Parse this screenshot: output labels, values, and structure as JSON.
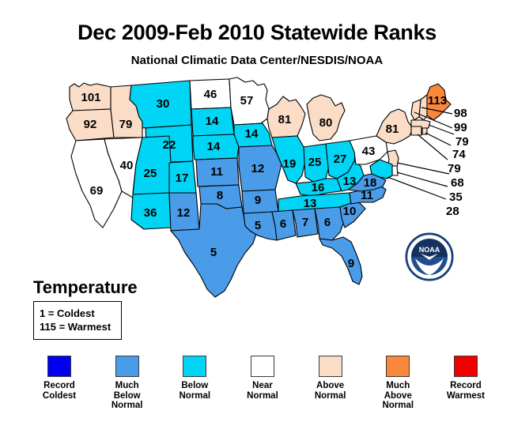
{
  "header": {
    "title": "Dec 2009-Feb 2010 Statewide Ranks",
    "subtitle": "National Climatic Data Center/NESDIS/NOAA"
  },
  "temperature_panel": {
    "heading": "Temperature",
    "scale_min": "1 = Coldest",
    "scale_max": "115 = Warmest"
  },
  "legend": {
    "items": [
      {
        "label": "Record\nColdest",
        "color": "#0000ee"
      },
      {
        "label": "Much\nBelow\nNormal",
        "color": "#4a9be8"
      },
      {
        "label": "Below\nNormal",
        "color": "#00d5f5"
      },
      {
        "label": "Near\nNormal",
        "color": "#ffffff"
      },
      {
        "label": "Above\nNormal",
        "color": "#fbdcc6"
      },
      {
        "label": "Much\nAbove\nNormal",
        "color": "#f9873c"
      },
      {
        "label": "Record\nWarmest",
        "color": "#f00000"
      }
    ]
  },
  "logo": {
    "name": "NOAA",
    "text": "NOAA",
    "color": "#1a3f7a"
  },
  "chart_data": {
    "type": "map",
    "title": "Dec 2009-Feb 2010 Statewide Ranks",
    "subtitle": "National Climatic Data Center/NESDIS/NOAA",
    "value_name": "Statewide Temperature Rank",
    "value_range": [
      1,
      115
    ],
    "value_min_label": "1 = Coldest",
    "value_max_label": "115 = Warmest",
    "color_bins": [
      {
        "name": "Record Coldest",
        "color": "#0000ee"
      },
      {
        "name": "Much Below Normal",
        "color": "#4a9be8"
      },
      {
        "name": "Below Normal",
        "color": "#00d5f5"
      },
      {
        "name": "Near Normal",
        "color": "#ffffff"
      },
      {
        "name": "Above Normal",
        "color": "#fbdcc6"
      },
      {
        "name": "Much Above Normal",
        "color": "#f9873c"
      },
      {
        "name": "Record Warmest",
        "color": "#f00000"
      }
    ],
    "states": [
      {
        "code": "WA",
        "value": 101,
        "category": "Above Normal"
      },
      {
        "code": "OR",
        "value": 92,
        "category": "Above Normal"
      },
      {
        "code": "ID",
        "value": 79,
        "category": "Above Normal"
      },
      {
        "code": "MT",
        "value": 30,
        "category": "Below Normal"
      },
      {
        "code": "WY",
        "value": 22,
        "category": "Below Normal"
      },
      {
        "code": "CA",
        "value": 69,
        "category": "Near Normal"
      },
      {
        "code": "NV",
        "value": 40,
        "category": "Near Normal"
      },
      {
        "code": "UT",
        "value": 25,
        "category": "Below Normal"
      },
      {
        "code": "CO",
        "value": 17,
        "category": "Below Normal"
      },
      {
        "code": "AZ",
        "value": 36,
        "category": "Below Normal"
      },
      {
        "code": "NM",
        "value": 12,
        "category": "Much Below Normal"
      },
      {
        "code": "ND",
        "value": 46,
        "category": "Near Normal"
      },
      {
        "code": "SD",
        "value": 14,
        "category": "Below Normal"
      },
      {
        "code": "NE",
        "value": 14,
        "category": "Below Normal"
      },
      {
        "code": "KS",
        "value": 11,
        "category": "Much Below Normal"
      },
      {
        "code": "OK",
        "value": 8,
        "category": "Much Below Normal"
      },
      {
        "code": "TX",
        "value": 5,
        "category": "Much Below Normal"
      },
      {
        "code": "MN",
        "value": 57,
        "category": "Near Normal"
      },
      {
        "code": "IA",
        "value": 14,
        "category": "Below Normal"
      },
      {
        "code": "MO",
        "value": 12,
        "category": "Much Below Normal"
      },
      {
        "code": "AR",
        "value": 9,
        "category": "Much Below Normal"
      },
      {
        "code": "LA",
        "value": 5,
        "category": "Much Below Normal"
      },
      {
        "code": "WI",
        "value": 81,
        "category": "Above Normal"
      },
      {
        "code": "MI",
        "value": 80,
        "category": "Above Normal"
      },
      {
        "code": "IL",
        "value": 19,
        "category": "Below Normal"
      },
      {
        "code": "IN",
        "value": 25,
        "category": "Below Normal"
      },
      {
        "code": "OH",
        "value": 27,
        "category": "Below Normal"
      },
      {
        "code": "KY",
        "value": 16,
        "category": "Below Normal"
      },
      {
        "code": "TN",
        "value": 13,
        "category": "Below Normal"
      },
      {
        "code": "MS",
        "value": 6,
        "category": "Much Below Normal"
      },
      {
        "code": "AL",
        "value": 7,
        "category": "Much Below Normal"
      },
      {
        "code": "GA",
        "value": 6,
        "category": "Much Below Normal"
      },
      {
        "code": "FL",
        "value": 9,
        "category": "Much Below Normal"
      },
      {
        "code": "SC",
        "value": 10,
        "category": "Much Below Normal"
      },
      {
        "code": "NC",
        "value": 11,
        "category": "Much Below Normal"
      },
      {
        "code": "VA",
        "value": 18,
        "category": "Much Below Normal"
      },
      {
        "code": "WV",
        "value": 13,
        "category": "Below Normal"
      },
      {
        "code": "PA",
        "value": 43,
        "category": "Near Normal"
      },
      {
        "code": "NY",
        "value": 81,
        "category": "Above Normal"
      },
      {
        "code": "ME",
        "value": 113,
        "category": "Much Above Normal"
      },
      {
        "code": "NH",
        "value": 98,
        "category": "Above Normal"
      },
      {
        "code": "VT",
        "value": 99,
        "category": "Above Normal"
      },
      {
        "code": "MA",
        "value": 79,
        "category": "Above Normal"
      },
      {
        "code": "RI",
        "value": 74,
        "category": "Above Normal"
      },
      {
        "code": "CT",
        "value": 79,
        "category": "Above Normal"
      },
      {
        "code": "NJ",
        "value": 68,
        "category": "Above Normal"
      },
      {
        "code": "DE",
        "value": 35,
        "category": "Near Normal"
      },
      {
        "code": "MD",
        "value": 28,
        "category": "Below Normal"
      }
    ]
  },
  "map_labels": {
    "WA": "101",
    "OR": "92",
    "ID": "79",
    "MT": "30",
    "WY": "22",
    "CA": "69",
    "NV": "40",
    "UT": "25",
    "CO": "17",
    "AZ": "36",
    "NM": "12",
    "ND": "46",
    "SD": "14",
    "NE": "14",
    "KS": "11",
    "OK": "8",
    "TX": "5",
    "MN": "57",
    "IA": "14",
    "MO": "12",
    "AR": "9",
    "LA": "5",
    "WI": "81",
    "MI": "80",
    "IL": "19",
    "IN": "25",
    "OH": "27",
    "KY": "16",
    "TN": "13",
    "MS": "6",
    "AL": "7",
    "GA": "6",
    "FL": "9",
    "SC": "10",
    "NC": "11",
    "VA": "18",
    "WV": "13",
    "PA": "43",
    "NY": "81",
    "ME": "113",
    "NH": "98",
    "VT": "99",
    "MA": "79",
    "RI": "74",
    "CT": "79",
    "NJ": "68",
    "DE": "35",
    "MD": "28"
  }
}
